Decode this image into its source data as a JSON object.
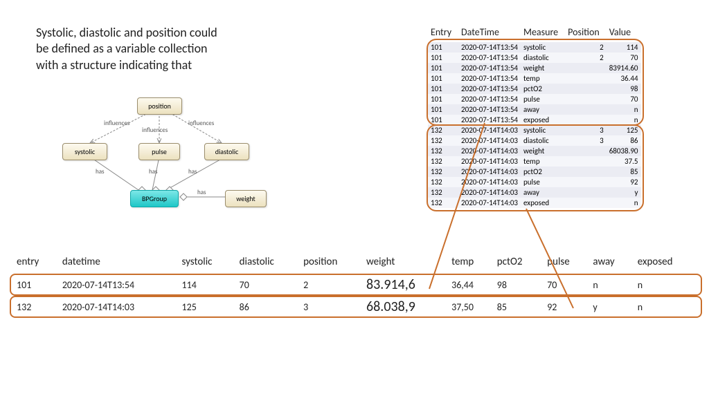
{
  "annotation": "Systolic, diastolic and position could\nbe defined as a variable collection\nwith a structure indicating that",
  "diagram": {
    "nodes": {
      "position": "position",
      "systolic": "systolic",
      "pulse": "pulse",
      "diastolic": "diastolic",
      "bpgroup": "BPGroup",
      "weight": "weight"
    },
    "edges": {
      "influences": "influences",
      "has": "has"
    }
  },
  "long_table": {
    "headers": [
      "Entry",
      "DateTime",
      "Measure",
      "Position",
      "Value"
    ],
    "rows": [
      [
        "101",
        "2020-07-14T13:54",
        "systolic",
        "2",
        "114"
      ],
      [
        "101",
        "2020-07-14T13:54",
        "diastolic",
        "2",
        "70"
      ],
      [
        "101",
        "2020-07-14T13:54",
        "weight",
        "",
        "83914.60"
      ],
      [
        "101",
        "2020-07-14T13:54",
        "temp",
        "",
        "36.44"
      ],
      [
        "101",
        "2020-07-14T13:54",
        "pctO2",
        "",
        "98"
      ],
      [
        "101",
        "2020-07-14T13:54",
        "pulse",
        "",
        "70"
      ],
      [
        "101",
        "2020-07-14T13:54",
        "away",
        "",
        "n"
      ],
      [
        "101",
        "2020-07-14T13:54",
        "exposed",
        "",
        "n"
      ],
      [
        "132",
        "2020-07-14T14:03",
        "systolic",
        "3",
        "125"
      ],
      [
        "132",
        "2020-07-14T14:03",
        "diastolic",
        "3",
        "86"
      ],
      [
        "132",
        "2020-07-14T14:03",
        "weight",
        "",
        "68038.90"
      ],
      [
        "132",
        "2020-07-14T14:03",
        "temp",
        "",
        "37.5"
      ],
      [
        "132",
        "2020-07-14T14:03",
        "pctO2",
        "",
        "85"
      ],
      [
        "132",
        "2020-07-14T14:03",
        "pulse",
        "",
        "92"
      ],
      [
        "132",
        "2020-07-14T14:03",
        "away",
        "",
        "y"
      ],
      [
        "132",
        "2020-07-14T14:03",
        "exposed",
        "",
        "n"
      ]
    ]
  },
  "wide_table": {
    "headers": [
      "entry",
      "datetime",
      "systolic",
      "diastolic",
      "position",
      "weight",
      "temp",
      "pctO2",
      "pulse",
      "away",
      "exposed"
    ],
    "rows": [
      [
        "101",
        "2020-07-14T13:54",
        "114",
        "70",
        "2",
        "83.914,6",
        "36,44",
        "98",
        "70",
        "n",
        "n"
      ],
      [
        "132",
        "2020-07-14T14:03",
        "125",
        "86",
        "3",
        "68.038,9",
        "37,50",
        "85",
        "92",
        "y",
        "n"
      ]
    ]
  },
  "colors": {
    "outline": "#c96f2c"
  }
}
